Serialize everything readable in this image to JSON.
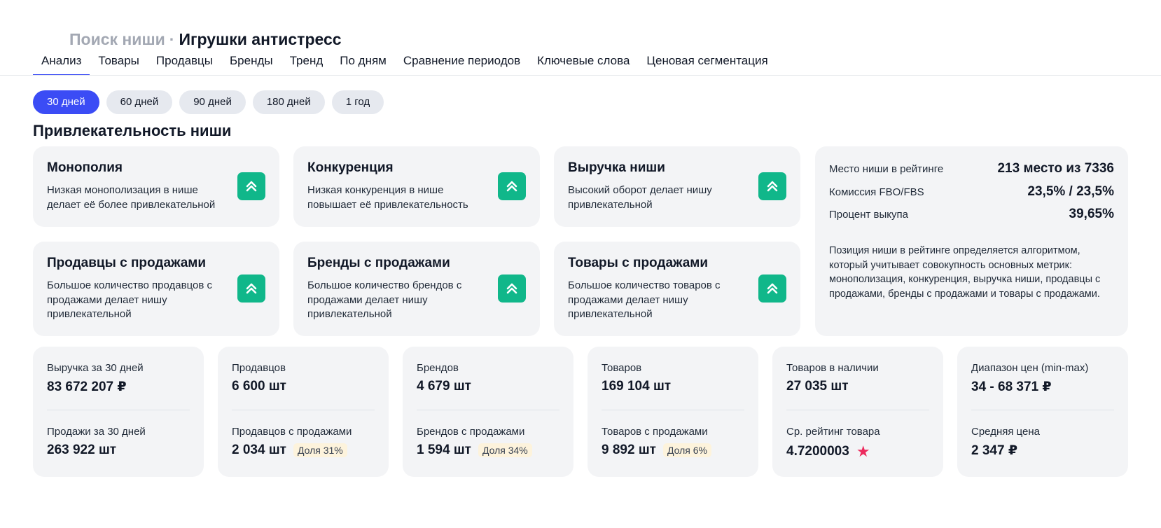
{
  "header": {
    "crumb": "Поиск ниши",
    "separator": "·",
    "title": "Игрушки антистресс"
  },
  "tabs": [
    "Анализ",
    "Товары",
    "Продавцы",
    "Бренды",
    "Тренд",
    "По дням",
    "Сравнение периодов",
    "Ключевые слова",
    "Ценовая сегментация"
  ],
  "active_tab": 0,
  "periods": [
    "30 дней",
    "60 дней",
    "90 дней",
    "180 дней",
    "1 год"
  ],
  "active_period": 0,
  "section_title": "Привлекательность ниши",
  "attractiveness": [
    {
      "title": "Монополия",
      "desc": "Низкая монополизация в нише делает её более привлекательной",
      "icon": "double-chevron-up-icon"
    },
    {
      "title": "Конкуренция",
      "desc": "Низкая конкуренция в нише повышает её привлекательность",
      "icon": "double-chevron-up-icon"
    },
    {
      "title": "Выручка ниши",
      "desc": "Высокий оборот делает нишу привлекательной",
      "icon": "double-chevron-up-icon"
    },
    {
      "title": "Продавцы с продажами",
      "desc": "Большое количество продавцов с продажами делает нишу привлекательной",
      "icon": "double-chevron-up-icon"
    },
    {
      "title": "Бренды с продажами",
      "desc": "Большое количество брендов с продажами делает нишу привлекательной",
      "icon": "double-chevron-up-icon"
    },
    {
      "title": "Товары с продажами",
      "desc": "Большое количество товаров с продажами делает нишу привлекательной",
      "icon": "double-chevron-up-icon"
    }
  ],
  "rank": {
    "rows": [
      {
        "label": "Место ниши в рейтинге",
        "value": "213 место из 7336"
      },
      {
        "label": "Комиссия FBO/FBS",
        "value": "23,5% / 23,5%"
      },
      {
        "label": "Процент выкупа",
        "value": "39,65%"
      }
    ],
    "note": "Позиция ниши в рейтинге определяется алгоритмом, который учитывает совокупность основных метрик: монополизация, конкуренция, выручка ниши, продавцы с продажами, бренды с продажами и товары с продажами."
  },
  "stats": [
    {
      "top_label": "Выручка за 30 дней",
      "top_value": "83 672 207 ₽",
      "bottom_label": "Продажи за 30 дней",
      "bottom_value": "263 922 шт",
      "badge": ""
    },
    {
      "top_label": "Продавцов",
      "top_value": "6 600 шт",
      "bottom_label": "Продавцов с продажами",
      "bottom_value": "2 034 шт",
      "badge": "Доля 31%"
    },
    {
      "top_label": "Брендов",
      "top_value": "4 679 шт",
      "bottom_label": "Брендов с продажами",
      "bottom_value": "1 594 шт",
      "badge": "Доля 34%"
    },
    {
      "top_label": "Товаров",
      "top_value": "169 104 шт",
      "bottom_label": "Товаров с продажами",
      "bottom_value": "9 892 шт",
      "badge": "Доля 6%"
    },
    {
      "top_label": "Товаров в наличии",
      "top_value": "27 035 шт",
      "bottom_label": "Ср. рейтинг товара",
      "bottom_value": "4.7200003",
      "badge": "",
      "star": "★"
    },
    {
      "top_label": "Диапазон цен (min-max)",
      "top_value": "34 - 68 371 ₽",
      "bottom_label": "Средняя цена",
      "bottom_value": "2 347 ₽",
      "badge": ""
    }
  ],
  "colors": {
    "accent": "#3b4cf5",
    "positive": "#10b78a",
    "card_bg": "#f3f4f6",
    "badge_bg": "#fdf3dc",
    "star": "#ec2a5d"
  }
}
